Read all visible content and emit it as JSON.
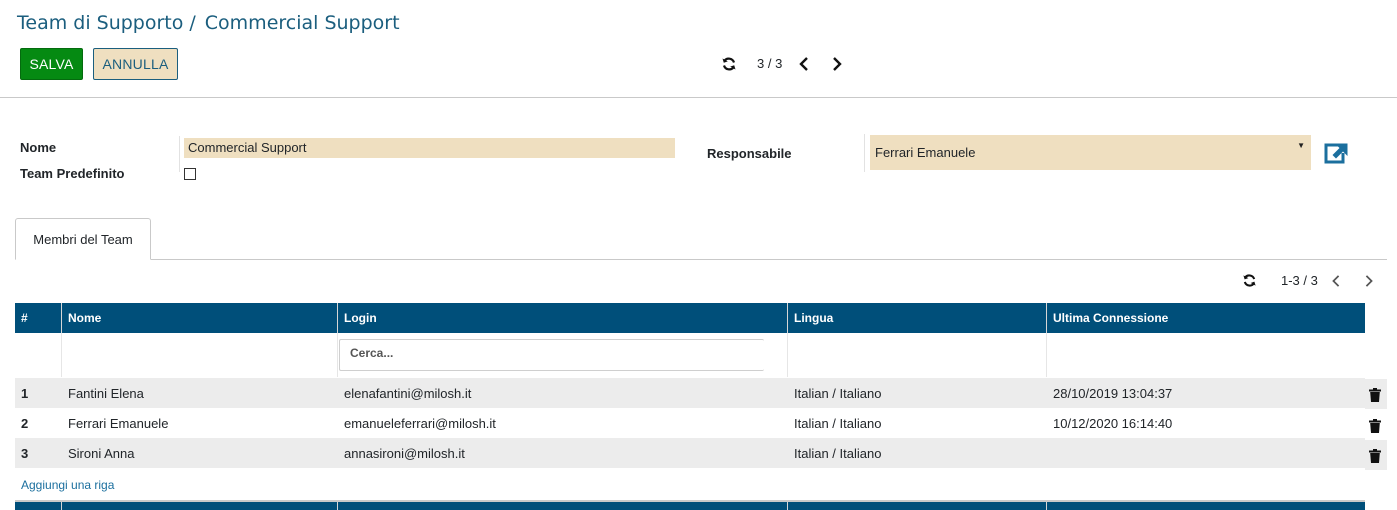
{
  "breadcrumb": {
    "parent": "Team di Supporto",
    "separator": "/",
    "current": "Commercial Support"
  },
  "toolbar": {
    "save_label": "SALVA",
    "cancel_label": "ANNULLA"
  },
  "record_pager": {
    "value": "3 / 3"
  },
  "form": {
    "name_label": "Nome",
    "name_value": "Commercial Support",
    "default_team_label": "Team Predefinito",
    "default_team_checked": false,
    "manager_label": "Responsabile",
    "manager_value": "Ferrari Emanuele"
  },
  "tabs": [
    {
      "label": "Membri del Team"
    }
  ],
  "list_pager": {
    "value": "1-3 / 3"
  },
  "table": {
    "headers": [
      "#",
      "Nome",
      "Login",
      "Lingua",
      "Ultima Connessione"
    ],
    "search_placeholder": "Cerca...",
    "rows": [
      {
        "num": "1",
        "name": "Fantini Elena",
        "login": "elenafantini@milosh.it",
        "lang": "Italian / Italiano",
        "last": "28/10/2019 13:04:37"
      },
      {
        "num": "2",
        "name": "Ferrari Emanuele",
        "login": "emanueleferrari@milosh.it",
        "lang": "Italian / Italiano",
        "last": "10/12/2020 16:14:40"
      },
      {
        "num": "3",
        "name": "Sironi Anna",
        "login": "annasironi@milosh.it",
        "lang": "Italian / Italiano",
        "last": ""
      }
    ],
    "add_row_label": "Aggiungi una riga"
  },
  "colors": {
    "primary": "#004f7a",
    "save": "#058a12",
    "field_bg": "#efdfc0",
    "link": "#1b5e7e"
  },
  "icons": [
    "refresh-icon",
    "chevron-left-icon",
    "chevron-right-icon",
    "external-link-icon",
    "trash-icon",
    "caret-down-icon"
  ]
}
